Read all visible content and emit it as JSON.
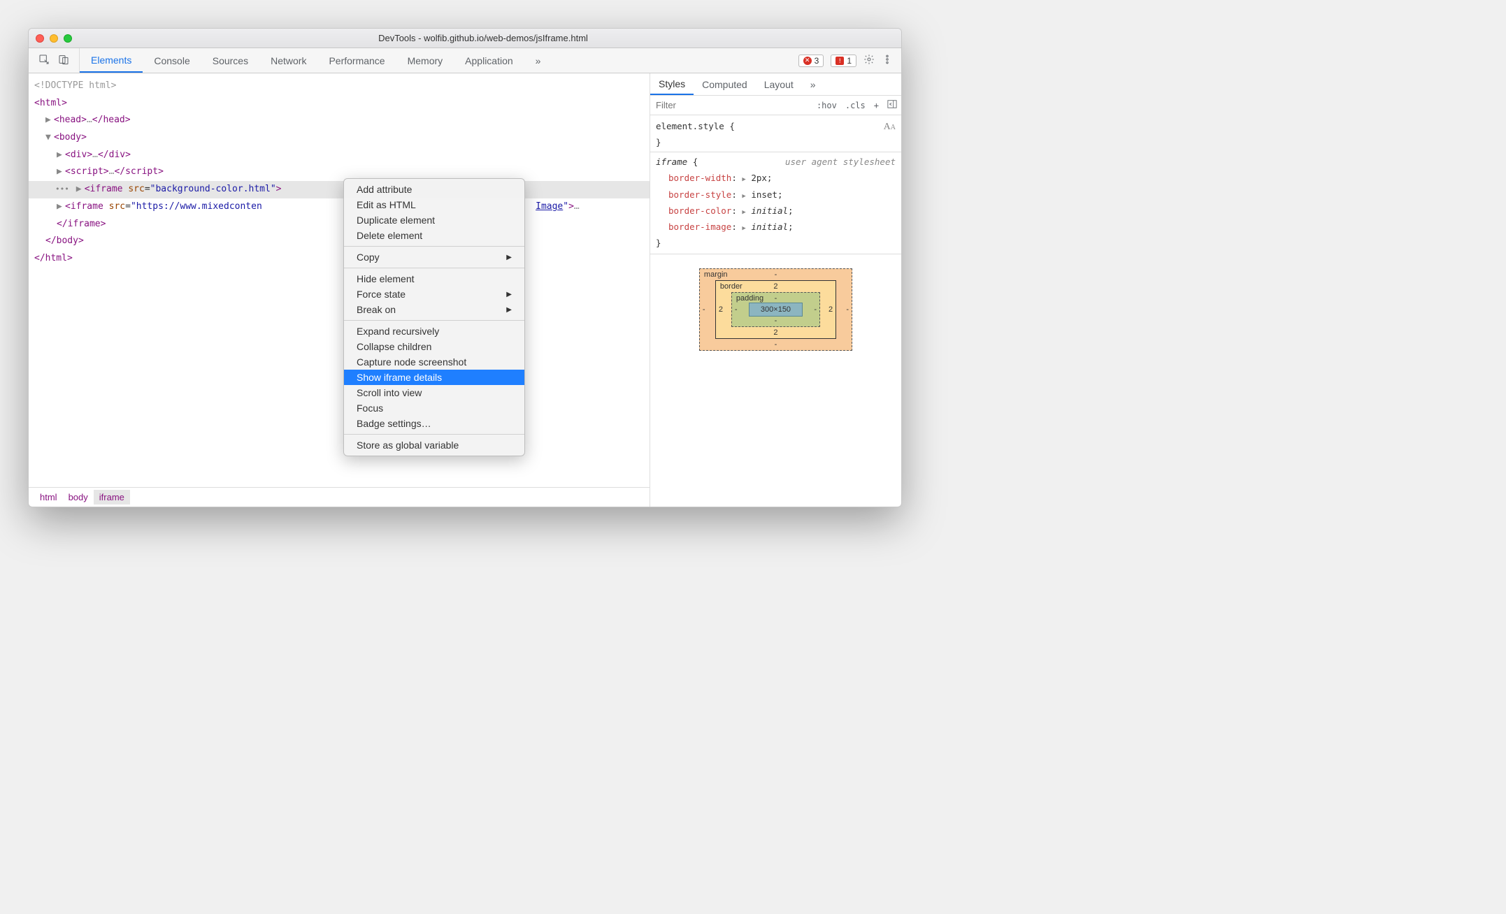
{
  "window": {
    "title": "DevTools - wolfib.github.io/web-demos/jsIframe.html"
  },
  "main_tabs": [
    "Elements",
    "Console",
    "Sources",
    "Network",
    "Performance",
    "Memory",
    "Application"
  ],
  "main_tab_active": "Elements",
  "error_count": "3",
  "issue_count": "1",
  "dom": {
    "doctype": "<!DOCTYPE html>",
    "html_open": "html",
    "head": "head",
    "body_open": "body",
    "div": "div",
    "script": "script",
    "iframe1_src": "background-color.html",
    "iframe2_src_prefix": "https://www.mixedconten",
    "iframe2_title_suffix": "Image",
    "ellipsis": "…",
    "body_close": "body",
    "html_close": "html"
  },
  "breadcrumbs": [
    "html",
    "body",
    "iframe"
  ],
  "context_menu": {
    "group1": [
      "Add attribute",
      "Edit as HTML",
      "Duplicate element",
      "Delete element"
    ],
    "group2": [
      {
        "label": "Copy",
        "submenu": true
      }
    ],
    "group3": [
      {
        "label": "Hide element",
        "submenu": false
      },
      {
        "label": "Force state",
        "submenu": true
      },
      {
        "label": "Break on",
        "submenu": true
      }
    ],
    "group4": [
      "Expand recursively",
      "Collapse children",
      "Capture node screenshot",
      "Show iframe details",
      "Scroll into view",
      "Focus",
      "Badge settings…"
    ],
    "group5": [
      "Store as global variable"
    ],
    "selected": "Show iframe details"
  },
  "styles_tabs": [
    "Styles",
    "Computed",
    "Layout"
  ],
  "styles_tab_active": "Styles",
  "filter_placeholder": "Filter",
  "filter_buttons": {
    "hov": ":hov",
    "cls": ".cls",
    "plus": "+"
  },
  "styles": {
    "element_style": "element.style",
    "brace_open": "{",
    "brace_close": "}",
    "iframe_selector": "iframe",
    "ua_comment": "user agent stylesheet",
    "props": [
      {
        "name": "border-width",
        "val": "2px",
        "expand": true
      },
      {
        "name": "border-style",
        "val": "inset",
        "expand": true
      },
      {
        "name": "border-color",
        "val": "initial",
        "expand": true,
        "italic": true
      },
      {
        "name": "border-image",
        "val": "initial",
        "expand": true,
        "italic": true
      }
    ]
  },
  "box_model": {
    "margin_label": "margin",
    "border_label": "border",
    "padding_label": "padding",
    "margin": {
      "top": "-",
      "right": "-",
      "bottom": "-",
      "left": "-"
    },
    "border": {
      "top": "2",
      "right": "2",
      "bottom": "2",
      "left": "2"
    },
    "padding": {
      "top": "-",
      "right": "-",
      "bottom": "-",
      "left": "-"
    },
    "content": "300×150"
  }
}
